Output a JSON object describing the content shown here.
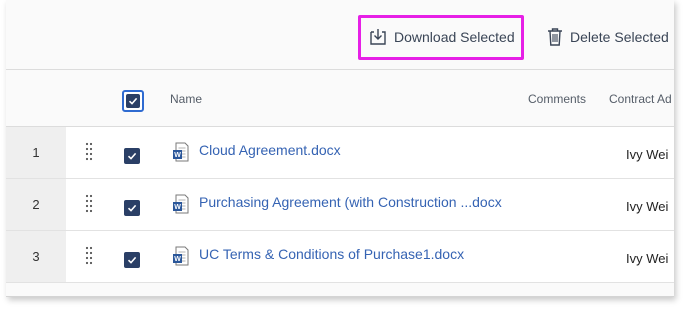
{
  "toolbar": {
    "download_label": "Download Selected",
    "delete_label": "Delete Selected"
  },
  "table": {
    "columns": {
      "name": "Name",
      "comments": "Comments",
      "contract_admin": "Contract Ad"
    },
    "rows": [
      {
        "num": "1",
        "file": "Cloud Agreement.docx",
        "admin": "Ivy Wei",
        "checked": true
      },
      {
        "num": "2",
        "file": "Purchasing Agreement (with Construction ...docx",
        "admin": "Ivy Wei",
        "checked": true
      },
      {
        "num": "3",
        "file": "UC Terms & Conditions of Purchase1.docx",
        "admin": "Ivy Wei",
        "checked": true
      }
    ]
  },
  "colors": {
    "highlight": "#e620e6",
    "checkbox": "#2a3f66",
    "link": "#3563b3",
    "word_blue": "#2b579a"
  },
  "icons": {
    "download": "download-tray-icon",
    "delete": "trash-icon",
    "file": "word-document-icon",
    "drag": "drag-handle-icon"
  }
}
